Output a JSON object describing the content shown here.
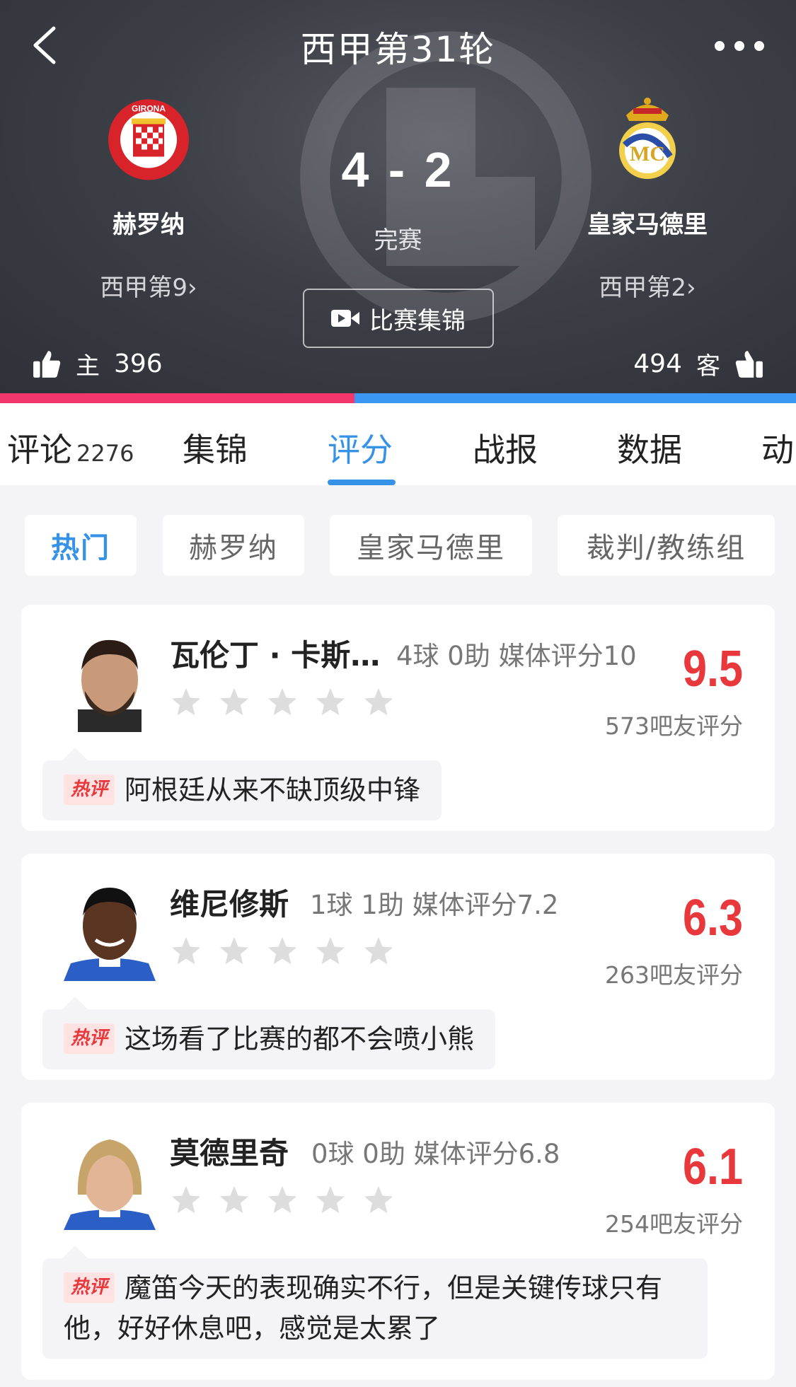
{
  "header": {
    "title": "西甲第31轮",
    "score": "4 - 2",
    "status": "完赛",
    "highlights_label": "比赛集锦",
    "home": {
      "name": "赫罗纳",
      "rank": "西甲第9",
      "crest_text": "GIRONA",
      "votes": "396",
      "side_label": "主"
    },
    "away": {
      "name": "皇家马德里",
      "rank": "西甲第2",
      "votes": "494",
      "side_label": "客"
    },
    "colors": {
      "home_bar": "#f3366b",
      "away_bar": "#3a97f2"
    }
  },
  "tabs": [
    {
      "label": "评论",
      "count": "2276"
    },
    {
      "label": "集锦"
    },
    {
      "label": "评分",
      "active": true
    },
    {
      "label": "战报"
    },
    {
      "label": "数据"
    },
    {
      "label": "动"
    }
  ],
  "filters": [
    {
      "label": "热门",
      "active": true
    },
    {
      "label": "赫罗纳"
    },
    {
      "label": "皇家马德里"
    },
    {
      "label": "裁判/教练组"
    }
  ],
  "players": [
    {
      "name": "瓦伦丁 · 卡斯…",
      "stats": "4球  0助   媒体评分10",
      "rating": "9.5",
      "rating_count": "573吧友评分",
      "hot_label": "热评",
      "comment": "阿根廷从来不缺顶级中锋"
    },
    {
      "name": "维尼修斯",
      "stats": "1球  1助   媒体评分7.2",
      "rating": "6.3",
      "rating_count": "263吧友评分",
      "hot_label": "热评",
      "comment": "这场看了比赛的都不会喷小熊"
    },
    {
      "name": "莫德里奇",
      "stats": "0球  0助   媒体评分6.8",
      "rating": "6.1",
      "rating_count": "254吧友评分",
      "hot_label": "热评",
      "comment": "魔笛今天的表现确实不行，但是关键传球只有他，好好休息吧，感觉是太累了"
    }
  ],
  "accent_color": "#3592e6",
  "rating_color": "#e8383c"
}
